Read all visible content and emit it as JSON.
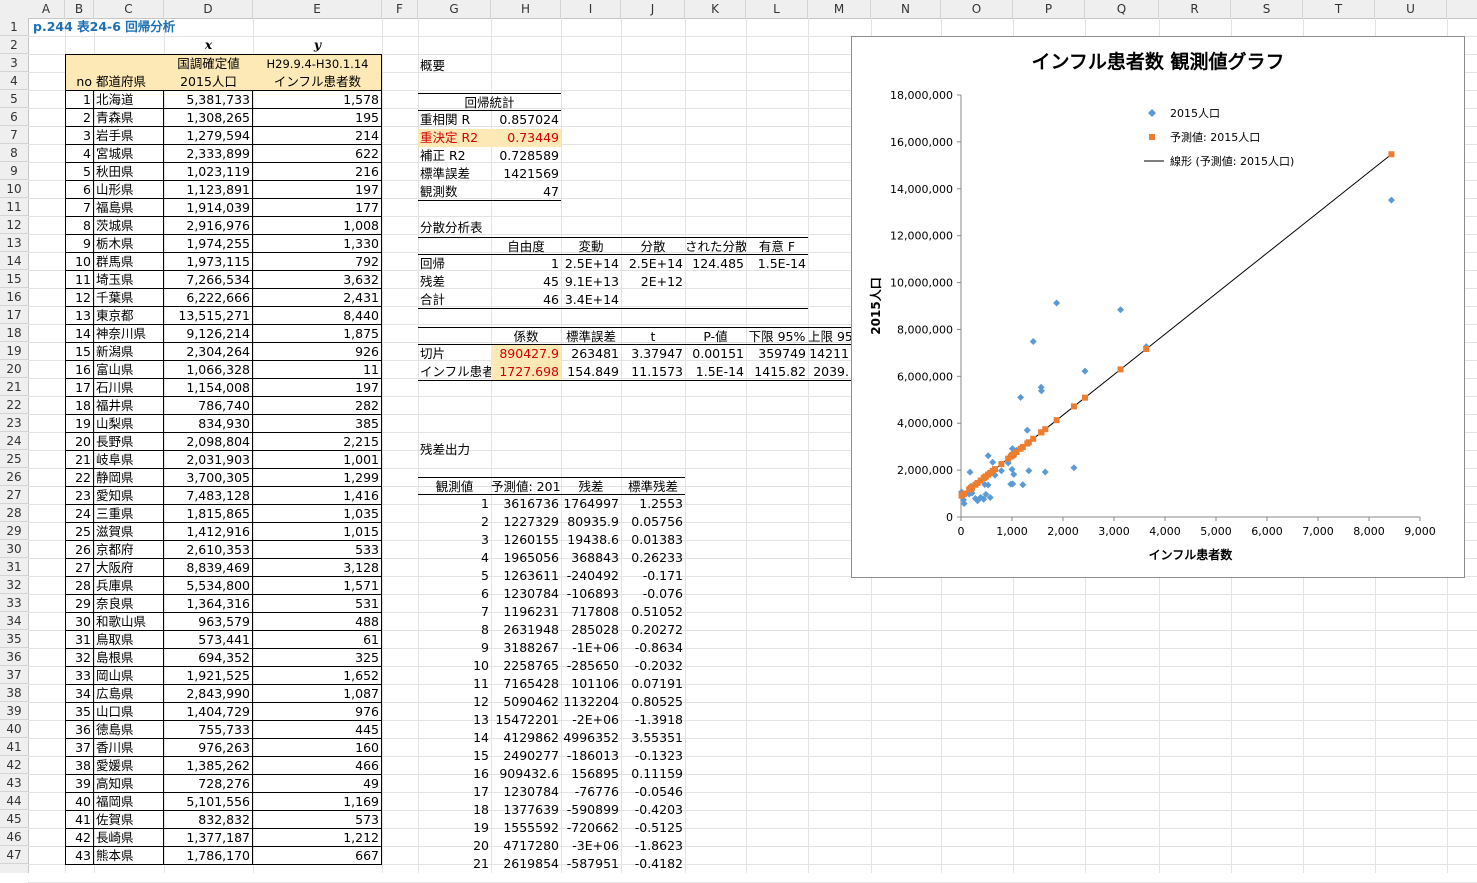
{
  "sheet_title": "p.244 表24-6 回帰分析",
  "columns": [
    "A",
    "B",
    "C",
    "D",
    "E",
    "F",
    "G",
    "H",
    "I",
    "J",
    "K",
    "L",
    "M",
    "N",
    "O",
    "P",
    "Q",
    "R",
    "S",
    "T",
    "U"
  ],
  "rows": [
    "1",
    "2",
    "3",
    "4",
    "5",
    "6",
    "7",
    "8",
    "9",
    "10",
    "11",
    "12",
    "13",
    "14",
    "15",
    "16",
    "17",
    "18",
    "19",
    "20",
    "21",
    "22",
    "23",
    "24",
    "25",
    "26",
    "27",
    "28",
    "29",
    "30",
    "31",
    "32",
    "33",
    "34",
    "35",
    "36",
    "37",
    "38",
    "39",
    "40",
    "41",
    "42",
    "43",
    "44",
    "45",
    "46",
    "47"
  ],
  "labels": {
    "x": "x",
    "y": "y",
    "d3": "国調確定値",
    "d4": "2015人口",
    "e3": "H29.9.4-H30.1.14",
    "e4": "インフル患者数",
    "no": "no",
    "pref": "都道府県"
  },
  "prefectures": [
    [
      "1",
      "北海道",
      "5,381,733",
      "1,578"
    ],
    [
      "2",
      "青森県",
      "1,308,265",
      "195"
    ],
    [
      "3",
      "岩手県",
      "1,279,594",
      "214"
    ],
    [
      "4",
      "宮城県",
      "2,333,899",
      "622"
    ],
    [
      "5",
      "秋田県",
      "1,023,119",
      "216"
    ],
    [
      "6",
      "山形県",
      "1,123,891",
      "197"
    ],
    [
      "7",
      "福島県",
      "1,914,039",
      "177"
    ],
    [
      "8",
      "茨城県",
      "2,916,976",
      "1,008"
    ],
    [
      "9",
      "栃木県",
      "1,974,255",
      "1,330"
    ],
    [
      "10",
      "群馬県",
      "1,973,115",
      "792"
    ],
    [
      "11",
      "埼玉県",
      "7,266,534",
      "3,632"
    ],
    [
      "12",
      "千葉県",
      "6,222,666",
      "2,431"
    ],
    [
      "13",
      "東京都",
      "13,515,271",
      "8,440"
    ],
    [
      "14",
      "神奈川県",
      "9,126,214",
      "1,875"
    ],
    [
      "15",
      "新潟県",
      "2,304,264",
      "926"
    ],
    [
      "16",
      "富山県",
      "1,066,328",
      "11"
    ],
    [
      "17",
      "石川県",
      "1,154,008",
      "197"
    ],
    [
      "18",
      "福井県",
      "786,740",
      "282"
    ],
    [
      "19",
      "山梨県",
      "834,930",
      "385"
    ],
    [
      "20",
      "長野県",
      "2,098,804",
      "2,215"
    ],
    [
      "21",
      "岐阜県",
      "2,031,903",
      "1,001"
    ],
    [
      "22",
      "静岡県",
      "3,700,305",
      "1,299"
    ],
    [
      "23",
      "愛知県",
      "7,483,128",
      "1,416"
    ],
    [
      "24",
      "三重県",
      "1,815,865",
      "1,035"
    ],
    [
      "25",
      "滋賀県",
      "1,412,916",
      "1,015"
    ],
    [
      "26",
      "京都府",
      "2,610,353",
      "533"
    ],
    [
      "27",
      "大阪府",
      "8,839,469",
      "3,128"
    ],
    [
      "28",
      "兵庫県",
      "5,534,800",
      "1,571"
    ],
    [
      "29",
      "奈良県",
      "1,364,316",
      "531"
    ],
    [
      "30",
      "和歌山県",
      "963,579",
      "488"
    ],
    [
      "31",
      "鳥取県",
      "573,441",
      "61"
    ],
    [
      "32",
      "島根県",
      "694,352",
      "325"
    ],
    [
      "33",
      "岡山県",
      "1,921,525",
      "1,652"
    ],
    [
      "34",
      "広島県",
      "2,843,990",
      "1,087"
    ],
    [
      "35",
      "山口県",
      "1,404,729",
      "976"
    ],
    [
      "36",
      "徳島県",
      "755,733",
      "445"
    ],
    [
      "37",
      "香川県",
      "976,263",
      "160"
    ],
    [
      "38",
      "愛媛県",
      "1,385,262",
      "466"
    ],
    [
      "39",
      "高知県",
      "728,276",
      "49"
    ],
    [
      "40",
      "福岡県",
      "5,101,556",
      "1,169"
    ],
    [
      "41",
      "佐賀県",
      "832,832",
      "573"
    ],
    [
      "42",
      "長崎県",
      "1,377,187",
      "1,212"
    ],
    [
      "43",
      "熊本県",
      "1,786,170",
      "667"
    ]
  ],
  "summary": {
    "title": "概要",
    "reg_title": "回帰統計",
    "reg": [
      [
        "重相関 R",
        "0.857024"
      ],
      [
        "重決定 R2",
        "0.73449"
      ],
      [
        "補正 R2",
        "0.728589"
      ],
      [
        "標準誤差",
        "1421569"
      ],
      [
        "観測数",
        "47"
      ]
    ],
    "anova_title": "分散分析表",
    "anova_head": [
      "自由度",
      "変動",
      "分散",
      "された分散",
      "有意 F"
    ],
    "anova": [
      [
        "回帰",
        "1",
        "2.5E+14",
        "2.5E+14",
        "124.485",
        "1.5E-14"
      ],
      [
        "残差",
        "45",
        "9.1E+13",
        "2E+12",
        "",
        ""
      ],
      [
        "合計",
        "46",
        "3.4E+14",
        "",
        "",
        ""
      ]
    ],
    "coef_head": [
      "係数",
      "標準誤差",
      "t",
      "P-値",
      "下限 95%",
      "上限 95%"
    ],
    "coef": [
      [
        "切片",
        "890427.9",
        "263481",
        "3.37947",
        "0.00151",
        "359749",
        "14211"
      ],
      [
        "インフル患者数",
        "1727.698",
        "154.849",
        "11.1573",
        "1.5E-14",
        "1415.82",
        "2039."
      ]
    ],
    "resid_title": "残差出力",
    "resid_head": [
      "観測値",
      "予測値: 2015人口",
      "残差",
      "標準残差"
    ],
    "resid": [
      [
        "1",
        "3616736",
        "1764997",
        "1.2553"
      ],
      [
        "2",
        "1227329",
        "80935.9",
        "0.05756"
      ],
      [
        "3",
        "1260155",
        "19438.6",
        "0.01383"
      ],
      [
        "4",
        "1965056",
        "368843",
        "0.26233"
      ],
      [
        "5",
        "1263611",
        "-240492",
        "-0.171"
      ],
      [
        "6",
        "1230784",
        "-106893",
        "-0.076"
      ],
      [
        "7",
        "1196231",
        "717808",
        "0.51052"
      ],
      [
        "8",
        "2631948",
        "285028",
        "0.20272"
      ],
      [
        "9",
        "3188267",
        "-1E+06",
        "-0.8634"
      ],
      [
        "10",
        "2258765",
        "-285650",
        "-0.2032"
      ],
      [
        "11",
        "7165428",
        "101106",
        "0.07191"
      ],
      [
        "12",
        "5090462",
        "1132204",
        "0.80525"
      ],
      [
        "13",
        "15472201",
        "-2E+06",
        "-1.3918"
      ],
      [
        "14",
        "4129862",
        "4996352",
        "3.55351"
      ],
      [
        "15",
        "2490277",
        "-186013",
        "-0.1323"
      ],
      [
        "16",
        "909432.6",
        "156895",
        "0.11159"
      ],
      [
        "17",
        "1230784",
        "-76776",
        "-0.0546"
      ],
      [
        "18",
        "1377639",
        "-590899",
        "-0.4203"
      ],
      [
        "19",
        "1555592",
        "-720662",
        "-0.5125"
      ],
      [
        "20",
        "4717280",
        "-3E+06",
        "-1.8623"
      ],
      [
        "21",
        "2619854",
        "-587951",
        "-0.4182"
      ]
    ]
  },
  "colors": {
    "accent": "#1f6fb5",
    "observed": "#5b9bd5",
    "predicted": "#ed7d31",
    "highlight": "#fde9b6"
  },
  "chart_data": {
    "type": "scatter",
    "title": "インフル患者数 観測値グラフ",
    "xlabel": "インフル患者数",
    "ylabel": "2015人口",
    "xlim": [
      0,
      9000
    ],
    "ylim": [
      0,
      18000000
    ],
    "xticks": [
      "0",
      "1,000",
      "2,000",
      "3,000",
      "4,000",
      "5,000",
      "6,000",
      "7,000",
      "8,000",
      "9,000"
    ],
    "yticks": [
      "0",
      "2,000,000",
      "4,000,000",
      "6,000,000",
      "8,000,000",
      "10,000,000",
      "12,000,000",
      "14,000,000",
      "16,000,000",
      "18,000,000"
    ],
    "legend": [
      "2015人口",
      "予測値: 2015人口",
      "線形 (予測値: 2015人口)"
    ],
    "legend_position": "top-right",
    "trend": {
      "intercept": 890427.9,
      "slope": 1727.698
    },
    "series": [
      {
        "name": "2015人口",
        "x": [
          1578,
          195,
          214,
          622,
          216,
          197,
          177,
          1008,
          1330,
          792,
          3632,
          2431,
          8440,
          1875,
          926,
          11,
          197,
          282,
          385,
          2215,
          1001,
          1299,
          1416,
          1035,
          1015,
          533,
          3128,
          1571,
          531,
          488,
          61,
          325,
          1652,
          1087,
          976,
          445,
          160,
          466,
          49,
          1169,
          573,
          1212,
          667
        ],
        "y": [
          5381733,
          1308265,
          1279594,
          2333899,
          1023119,
          1123891,
          1914039,
          2916976,
          1974255,
          1973115,
          7266534,
          6222666,
          13515271,
          9126214,
          2304264,
          1066328,
          1154008,
          786740,
          834930,
          2098804,
          2031903,
          3700305,
          7483128,
          1815865,
          1412916,
          2610353,
          8839469,
          5534800,
          1364316,
          963579,
          573441,
          694352,
          1921525,
          2843990,
          1404729,
          755733,
          976263,
          1385262,
          728276,
          5101556,
          832832,
          1377187,
          1786170
        ]
      },
      {
        "name": "予測値: 2015人口",
        "x": [
          1578,
          195,
          214,
          622,
          216,
          197,
          177,
          1008,
          1330,
          792,
          3632,
          2431,
          8440,
          1875,
          926,
          11,
          197,
          282,
          385,
          2215,
          1001,
          1299,
          1416,
          1035,
          1015,
          533,
          3128,
          1571,
          531,
          488,
          61,
          325,
          1652,
          1087,
          976,
          445,
          160,
          466,
          49,
          1169,
          573,
          1212,
          667
        ],
        "y": [
          3616736,
          1227329,
          1260155,
          1965056,
          1263611,
          1230784,
          1196231,
          2631948,
          3188267,
          2258765,
          7165428,
          5090462,
          15472201,
          4129862,
          2490277,
          909433,
          1230784,
          1377639,
          1555592,
          4717280,
          2619854,
          3134749,
          3336890,
          2678595,
          2644041,
          1811289,
          6294578,
          3604642,
          1807834,
          1733544,
          995818,
          1451931,
          3744626,
          2768434,
          2576661,
          1659256,
          1166859,
          1695536,
          975083,
          2910109,
          1880396,
          2984401,
          2042782
        ]
      }
    ]
  }
}
